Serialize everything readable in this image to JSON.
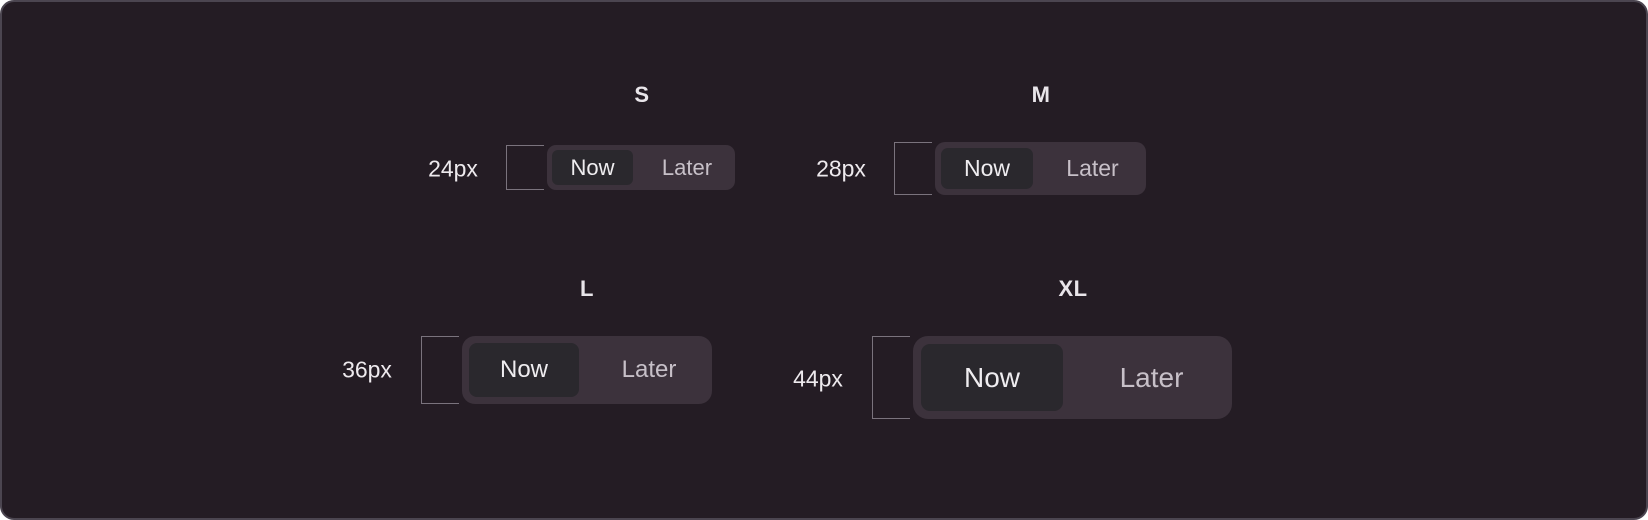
{
  "sizes": [
    {
      "id": "s",
      "title": "S",
      "height_label": "24px",
      "options": [
        "Now",
        "Later"
      ],
      "selected": "Now"
    },
    {
      "id": "m",
      "title": "M",
      "height_label": "28px",
      "options": [
        "Now",
        "Later"
      ],
      "selected": "Now"
    },
    {
      "id": "l",
      "title": "L",
      "height_label": "36px",
      "options": [
        "Now",
        "Later"
      ],
      "selected": "Now"
    },
    {
      "id": "xl",
      "title": "XL",
      "height_label": "44px",
      "options": [
        "Now",
        "Later"
      ],
      "selected": "Now"
    }
  ],
  "colors": {
    "background": "#241c24",
    "track": "#3c323c",
    "active_segment": "#2a282d",
    "active_text": "#efedf0",
    "inactive_text": "#c7c0c8",
    "bracket": "#7a737d"
  }
}
